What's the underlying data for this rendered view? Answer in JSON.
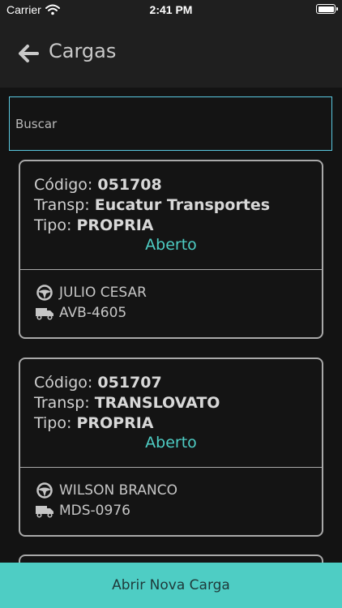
{
  "status_bar": {
    "carrier": "Carrier",
    "time": "2:41 PM"
  },
  "header": {
    "title": "Cargas"
  },
  "search": {
    "placeholder": "Buscar",
    "value": ""
  },
  "labels": {
    "codigo": "Código:",
    "transp": "Transp:",
    "tipo": "Tipo:"
  },
  "cards": [
    {
      "codigo": "051708",
      "transp": "Eucatur Transportes",
      "tipo": "PROPRIA",
      "status": "Aberto",
      "motorista": "JULIO CESAR",
      "placa": "AVB-4605"
    },
    {
      "codigo": "051707",
      "transp": "TRANSLOVATO",
      "tipo": "PROPRIA",
      "status": "Aberto",
      "motorista": "WILSON BRANCO",
      "placa": "MDS-0976"
    }
  ],
  "footer": {
    "button_label": "Abrir Nova Carga"
  },
  "colors": {
    "accent": "#4ecdc4",
    "search_border": "#5ac8e0",
    "background": "#131313",
    "header": "#1f1f1f",
    "card_border": "#a9a9a9"
  },
  "icons": {
    "back": "arrow-left-icon",
    "driver": "steering-wheel-icon",
    "vehicle": "truck-icon",
    "wifi": "wifi-icon",
    "battery": "battery-icon"
  }
}
